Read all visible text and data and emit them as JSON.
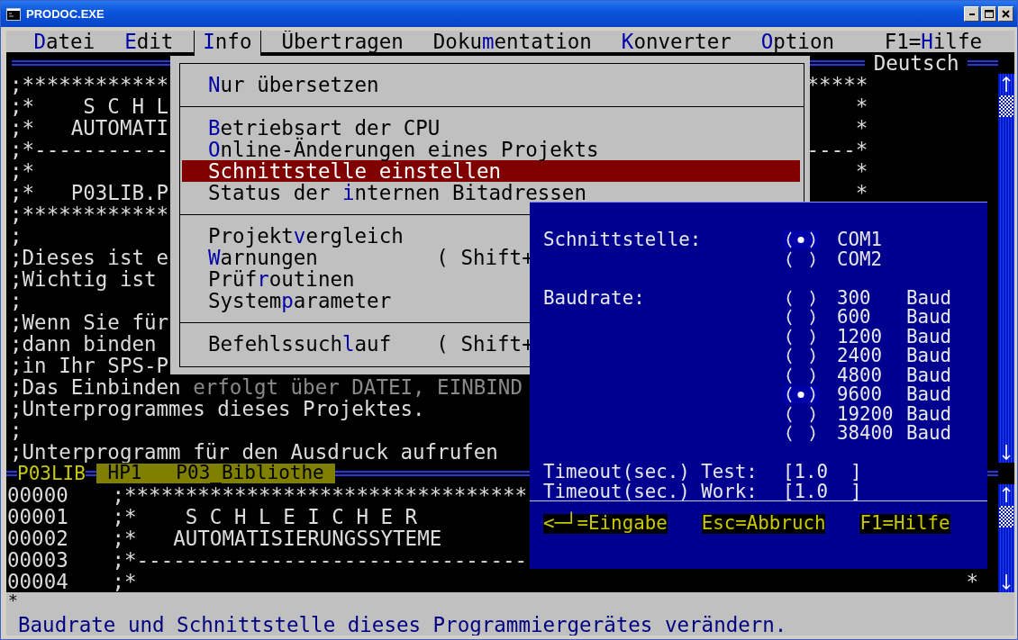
{
  "window": {
    "title": "PRODOC.EXE"
  },
  "menu_bar": [
    {
      "label": "**D**atei",
      "selected": false
    },
    {
      "label": "**E**dit",
      "selected": false
    },
    {
      "label": "**I**nfo",
      "selected": true
    },
    {
      "label": "Übertragen",
      "selected": false
    },
    {
      "label": "Doku**m**entation",
      "selected": false
    },
    {
      "label": "**K**onverter",
      "selected": false
    },
    {
      "label": "**O**ption",
      "selected": false
    }
  ],
  "help_hint": "F1=**H**ilfe",
  "info_menu": {
    "sections": [
      {
        "items": [
          {
            "label": "**N**ur übersetzen",
            "selected": false
          }
        ]
      },
      {
        "items": [
          {
            "label": "**B**etriebsart der CPU",
            "selected": false
          },
          {
            "label": "**O**nline-Änderungen eines Projekts",
            "selected": false
          },
          {
            "label": "Schnittstelle einstellen",
            "selected": true
          },
          {
            "label": "Status der **i**nternen Bitadressen",
            "selected": false
          }
        ]
      },
      {
        "items": [
          {
            "label": "Projekt**v**ergleich",
            "selected": false
          },
          {
            "label": "**W**arnungen",
            "shortcut": "( Shift+",
            "selected": false
          },
          {
            "label": "Prüf**r**outinen",
            "selected": false
          },
          {
            "label": "System**p**arameter",
            "selected": false
          }
        ]
      },
      {
        "items": [
          {
            "label": "Befehlssuch**l**auf",
            "shortcut": "( Shift+",
            "selected": false
          }
        ]
      }
    ]
  },
  "top_editor": {
    "language": "Deutsch",
    "lines": [
      {
        "text": ";************",
        "right": "*****"
      },
      {
        "text": ";*    S C H L",
        "right": "*"
      },
      {
        "text": ";*   AUTOMATI",
        "right": "*"
      },
      {
        "text": ";*-----------",
        "right": "----*"
      },
      {
        "text": ";*",
        "right": "*"
      },
      {
        "text": ";*   P03LIB.P",
        "right": "*"
      },
      {
        "text": ";************"
      },
      {
        "text": ";"
      },
      {
        "text": ";Dieses ist e"
      },
      {
        "text": ";Wichtig ist"
      },
      {
        "text": ";"
      },
      {
        "text": ";Wenn Sie für"
      },
      {
        "text": ";dann binden"
      },
      {
        "text": ";in Ihr SPS-P"
      },
      {
        "text": ";Das Einbinden",
        "shadowed": "erfolgt über DATEI, EINBIND"
      },
      {
        "text": ";Unterprogrammes dieses Projektes."
      },
      {
        "text": ";"
      },
      {
        "text": ";Unterprogramm für den Ausdruck aufrufen"
      }
    ]
  },
  "bottom_editor": {
    "file": "P03LIB",
    "tag": "HP1",
    "title": "P03_Bibliothe",
    "lines": [
      {
        "number": "00000",
        "text": ";*********************************"
      },
      {
        "number": "00001",
        "text": ";*    S C H L E I C H E R"
      },
      {
        "number": "00002",
        "text": ";*   AUTOMATISIERUNGSSYTEME"
      },
      {
        "number": "00003",
        "text": ";*--------------------------------"
      },
      {
        "number": "00004",
        "text": ";*",
        "right": "*"
      }
    ]
  },
  "command_line": "*",
  "dialog": {
    "groups": [
      {
        "label": "Schnittstelle:",
        "options": [
          {
            "value": "COM1",
            "selected": true
          },
          {
            "value": "COM2",
            "selected": false
          }
        ]
      },
      {
        "label": "Baudrate:",
        "options": [
          {
            "value": "300",
            "unit": "Baud",
            "selected": false
          },
          {
            "value": "600",
            "unit": "Baud",
            "selected": false
          },
          {
            "value": "1200",
            "unit": "Baud",
            "selected": false
          },
          {
            "value": "2400",
            "unit": "Baud",
            "selected": false
          },
          {
            "value": "4800",
            "unit": "Baud",
            "selected": false
          },
          {
            "value": "9600",
            "unit": "Baud",
            "selected": true
          },
          {
            "value": "19200",
            "unit": "Baud",
            "selected": false
          },
          {
            "value": "38400",
            "unit": "Baud",
            "selected": false
          }
        ]
      }
    ],
    "fields": [
      {
        "label": "Timeout(sec.) Test:",
        "value": "[1.0  ]"
      },
      {
        "label": "Timeout(sec.) Work:",
        "value": "[1.0  ]"
      }
    ],
    "keys": [
      "<─┘=Eingabe",
      "Esc=Abbruch",
      "F1=Hilfe"
    ]
  },
  "status_bar": "Baudrate und Schnittstelle dieses Programmiergerätes verändern."
}
